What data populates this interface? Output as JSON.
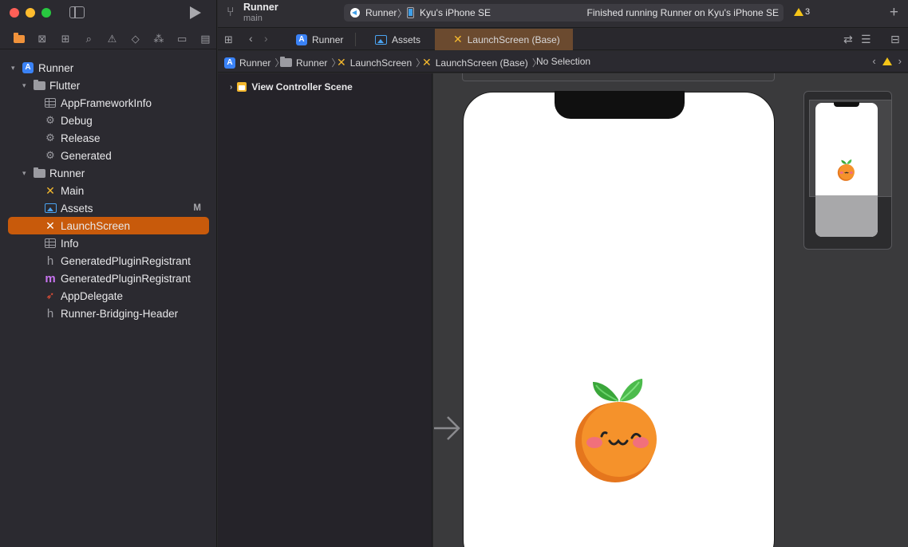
{
  "sidebar": {
    "tree": [
      {
        "label": "Runner",
        "kind": "project",
        "depth": 0,
        "expanded": true
      },
      {
        "label": "Flutter",
        "kind": "folder",
        "depth": 1,
        "expanded": true
      },
      {
        "label": "AppFrameworkInfo",
        "kind": "plist",
        "depth": 2
      },
      {
        "label": "Debug",
        "kind": "xcconfig",
        "depth": 2
      },
      {
        "label": "Release",
        "kind": "xcconfig",
        "depth": 2
      },
      {
        "label": "Generated",
        "kind": "xcconfig",
        "depth": 2
      },
      {
        "label": "Runner",
        "kind": "folder",
        "depth": 1,
        "expanded": true
      },
      {
        "label": "Main",
        "kind": "storyboard",
        "depth": 2
      },
      {
        "label": "Assets",
        "kind": "assets",
        "depth": 2,
        "badge": "M"
      },
      {
        "label": "LaunchScreen",
        "kind": "storyboard",
        "depth": 2,
        "selected": true
      },
      {
        "label": "Info",
        "kind": "plist",
        "depth": 2
      },
      {
        "label": "GeneratedPluginRegistrant",
        "kind": "header",
        "depth": 2
      },
      {
        "label": "GeneratedPluginRegistrant",
        "kind": "objc",
        "depth": 2
      },
      {
        "label": "AppDelegate",
        "kind": "swift",
        "depth": 2
      },
      {
        "label": "Runner-Bridging-Header",
        "kind": "header",
        "depth": 2
      }
    ]
  },
  "toolbar": {
    "project_name": "Runner",
    "branch": "main",
    "scheme": "Runner",
    "device": "Kyu's iPhone SE",
    "status": "Finished running Runner on Kyu's iPhone SE",
    "warning_count": "3"
  },
  "tabs": [
    {
      "label": "Runner",
      "icon": "project-icon",
      "active": false
    },
    {
      "label": "Assets",
      "icon": "assets-icon",
      "active": false
    },
    {
      "label": "LaunchScreen (Base)",
      "icon": "storyboard-icon",
      "active": true
    }
  ],
  "jumpbar": {
    "items": [
      "Runner",
      "Runner",
      "LaunchScreen",
      "LaunchScreen (Base)",
      "No Selection"
    ]
  },
  "outline": {
    "scene_label": "View Controller Scene"
  },
  "colors": {
    "accent": "#c85a0b",
    "storyboard_icon": "#f5b92e",
    "orange_mascot": "#f5922b",
    "leaf": "#3aa63a"
  }
}
